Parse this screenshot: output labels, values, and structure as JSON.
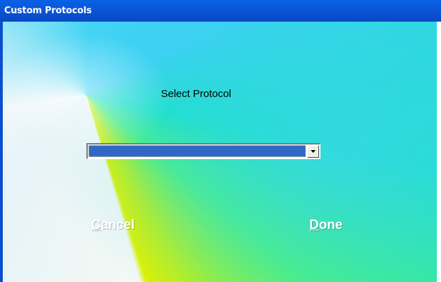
{
  "window": {
    "title": "Custom Protocols"
  },
  "dialog": {
    "heading": "Select Protocol",
    "protocol_select": {
      "selected_value": "",
      "arrow_icon": "chevron-down-icon"
    },
    "buttons": {
      "cancel": {
        "mnemonic": "C",
        "rest": "ancel"
      },
      "done": {
        "mnemonic": "D",
        "rest": "one"
      }
    }
  },
  "colors": {
    "titlebar": "#0a56d8",
    "selection": "#3168c5",
    "button_text": "#ffffff"
  }
}
